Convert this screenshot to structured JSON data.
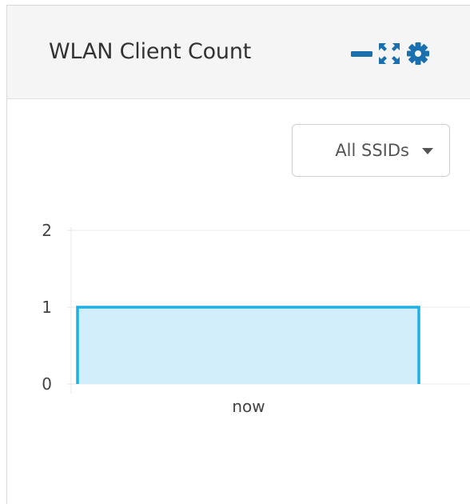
{
  "widget": {
    "title": "WLAN Client Count",
    "icons": [
      "minimize-icon",
      "expand-icon",
      "gear-icon"
    ]
  },
  "filter": {
    "selected": "All SSIDs"
  },
  "colors": {
    "icon": "#1a6fae",
    "bar_stroke": "#1fb0e6",
    "bar_fill": "#d2eefa",
    "grid": "#e8e8e8",
    "axis_text": "#444444"
  },
  "chart_data": {
    "type": "area",
    "categories": [
      "now"
    ],
    "values": [
      1
    ],
    "ylim": [
      0,
      2
    ],
    "yticks": [
      "0",
      "1",
      "2"
    ],
    "title": "",
    "xlabel": "",
    "ylabel": "",
    "grid": true
  }
}
